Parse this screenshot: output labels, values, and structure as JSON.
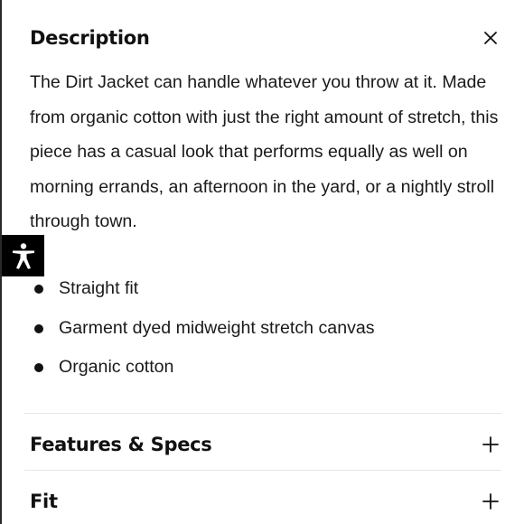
{
  "description": {
    "title": "Description",
    "close_icon": "close-icon",
    "body": "The Dirt Jacket can handle whatever you throw at it. Made from organic cotton with just the right amount of stretch, this piece has a casual look that performs equally as well on morning errands, an afternoon in the yard, or a nightly stroll through town.",
    "bullets": [
      "Straight fit",
      "Garment dyed midweight stretch canvas",
      "Organic cotton"
    ]
  },
  "sections": [
    {
      "title": "Features & Specs",
      "icon": "plus-icon"
    },
    {
      "title": "Fit",
      "icon": "plus-icon"
    }
  ],
  "accessibility": {
    "icon": "accessibility-icon"
  },
  "colors": {
    "text": "#111111",
    "divider": "#e6e6e6",
    "a11y_bg": "#000000"
  }
}
